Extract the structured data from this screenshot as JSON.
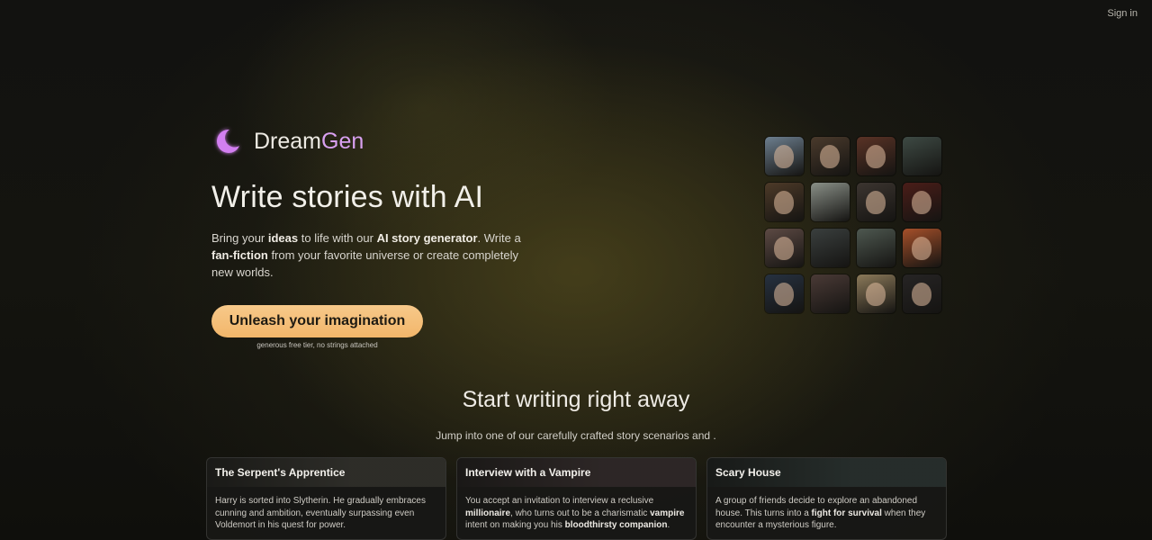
{
  "header": {
    "signin_label": "Sign in"
  },
  "brand": {
    "name_part1": "Dream",
    "name_part2": "Gen",
    "logo_icon": "moon-icon",
    "accent_color": "#d8a0f0"
  },
  "hero": {
    "headline": "Write stories with AI",
    "subtext_parts": [
      "Bring your ",
      "ideas",
      " to life with our ",
      "AI story generator",
      ". Write a ",
      "fan-fiction",
      " from your favorite universe or create completely new worlds."
    ],
    "cta_label": "Unleash your imagination",
    "cta_note": "generous free tier, no strings attached",
    "cta_color": "#f5c07a"
  },
  "avatars": [
    {
      "label": "elf-portrait",
      "bg": "#6d7f8f",
      "type": "face"
    },
    {
      "label": "bearded-man-portrait",
      "bg": "#4a3a2c",
      "type": "face"
    },
    {
      "label": "red-haired-woman-portrait",
      "bg": "#5a3326",
      "type": "face"
    },
    {
      "label": "forest-scene",
      "bg": "#3e4a44",
      "type": "scene"
    },
    {
      "label": "warrior-man-portrait",
      "bg": "#4d3a28",
      "type": "face"
    },
    {
      "label": "ruined-city-scene",
      "bg": "#8a9088",
      "type": "scene"
    },
    {
      "label": "long-haired-man-portrait",
      "bg": "#3c3530",
      "type": "face"
    },
    {
      "label": "suited-man-portrait",
      "bg": "#4a1d18",
      "type": "face"
    },
    {
      "label": "anime-girl-portrait",
      "bg": "#5d4a44",
      "type": "face"
    },
    {
      "label": "portal-scene",
      "bg": "#3a3f3e",
      "type": "scene"
    },
    {
      "label": "floating-island-scene",
      "bg": "#4e5850",
      "type": "scene"
    },
    {
      "label": "orange-haired-girl-portrait",
      "bg": "#a6502a",
      "type": "face"
    },
    {
      "label": "dark-haired-woman-portrait",
      "bg": "#263140",
      "type": "face"
    },
    {
      "label": "group-scene",
      "bg": "#4a3a36",
      "type": "scene"
    },
    {
      "label": "blonde-girl-portrait",
      "bg": "#8c7a5a",
      "type": "face"
    },
    {
      "label": "gothic-woman-portrait",
      "bg": "#262424",
      "type": "face"
    }
  ],
  "start": {
    "title": "Start writing right away",
    "subtitle": "Jump into one of our carefully crafted story scenarios and ."
  },
  "cards": [
    {
      "title": "The Serpent's Apprentice",
      "header_bg": "#3b3a34",
      "body": [
        {
          "t": "Harry is sorted into Slytherin. He gradually embraces cunning and ambition, eventually surpassing even Voldemort in his quest for power.",
          "b": false
        }
      ]
    },
    {
      "title": "Interview with a Vampire",
      "header_bg": "#3a3030",
      "body": [
        {
          "t": "You accept an invitation to interview a reclusive ",
          "b": false
        },
        {
          "t": "millionaire",
          "b": true
        },
        {
          "t": ", who turns out to be a charismatic ",
          "b": false
        },
        {
          "t": "vampire",
          "b": true
        },
        {
          "t": " intent on making you his ",
          "b": false
        },
        {
          "t": "bloodthirsty companion",
          "b": true
        },
        {
          "t": ".",
          "b": false
        }
      ]
    },
    {
      "title": "Scary House",
      "header_bg": "#2f3a38",
      "body": [
        {
          "t": "A group of friends decide to explore an abandoned house. This turns into a ",
          "b": false
        },
        {
          "t": "fight for survival",
          "b": true
        },
        {
          "t": " when they encounter a mysterious figure.",
          "b": false
        }
      ]
    }
  ]
}
